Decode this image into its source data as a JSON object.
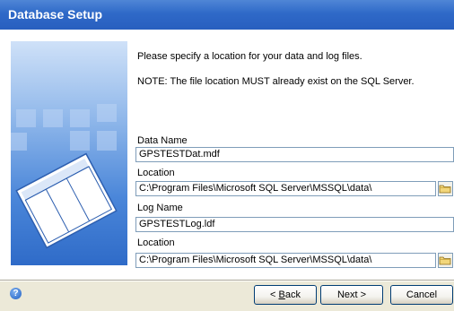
{
  "window": {
    "title": "Database Setup"
  },
  "intro": {
    "line1": "Please specify a location for your data and log files.",
    "line2": "NOTE: The file location MUST already exist on the SQL Server."
  },
  "fields": {
    "data_name_label": "Data Name",
    "data_name_value": "GPSTESTDat.mdf",
    "data_location_label": "Location",
    "data_location_value": "C:\\Program Files\\Microsoft SQL Server\\MSSQL\\data\\",
    "log_name_label": "Log Name",
    "log_name_value": "GPSTESTLog.ldf",
    "log_location_label": "Location",
    "log_location_value": "C:\\Program Files\\Microsoft SQL Server\\MSSQL\\data\\"
  },
  "buttons": {
    "back_prefix": "< ",
    "back_key": "B",
    "back_rest": "ack",
    "next": "Next >",
    "cancel": "Cancel"
  },
  "icons": {
    "help": "help-icon",
    "folder": "folder-icon",
    "graphic": "database-table-illustration"
  },
  "colors": {
    "title_bar": "#2f69c8",
    "field_border": "#7f9db9"
  }
}
